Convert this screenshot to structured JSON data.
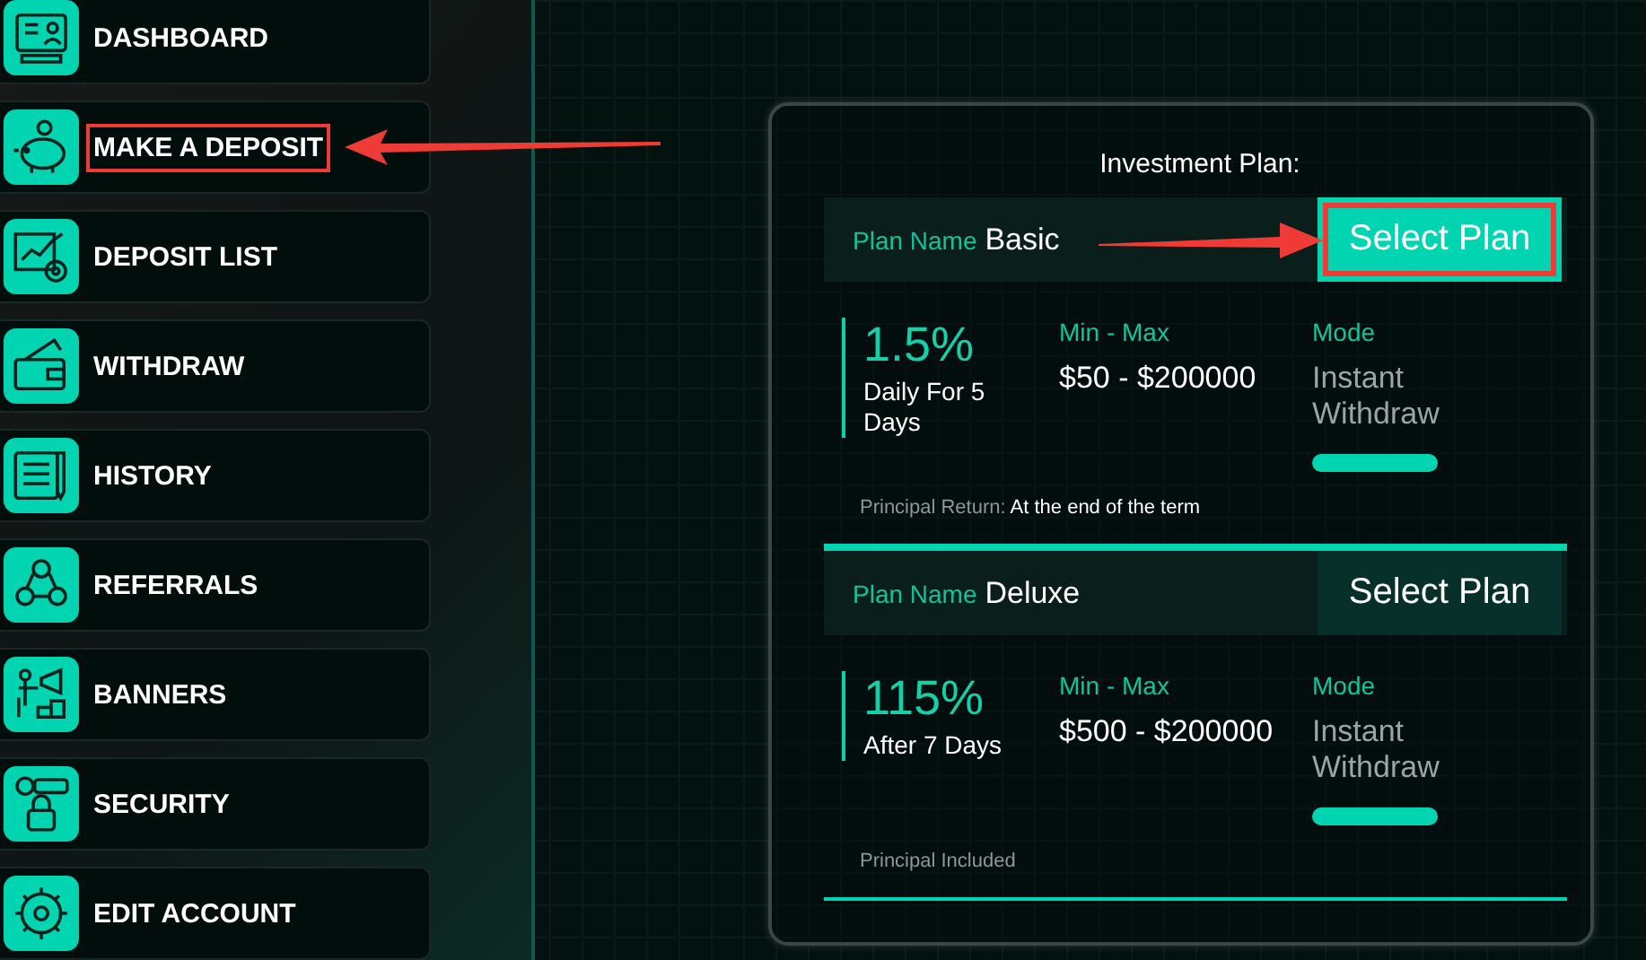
{
  "sidebar": {
    "items": [
      {
        "label": "DASHBOARD",
        "highlighted": false
      },
      {
        "label": "MAKE A DEPOSIT",
        "highlighted": true
      },
      {
        "label": "DEPOSIT LIST",
        "highlighted": false
      },
      {
        "label": "WITHDRAW",
        "highlighted": false
      },
      {
        "label": "HISTORY",
        "highlighted": false
      },
      {
        "label": "REFERRALS",
        "highlighted": false
      },
      {
        "label": "BANNERS",
        "highlighted": false
      },
      {
        "label": "SECURITY",
        "highlighted": false
      },
      {
        "label": "EDIT ACCOUNT",
        "highlighted": false
      }
    ]
  },
  "investment": {
    "title": "Investment Plan:",
    "plans": [
      {
        "name_label": "Plan Name",
        "name": "Basic",
        "button": "Select Plan",
        "selected": true,
        "highlighted": true,
        "rate": "1.5%",
        "term": "Daily For 5 Days",
        "range_label": "Min - Max",
        "range": "$50 - $200000",
        "mode_label": "Mode",
        "mode": "Instant Withdraw",
        "principal_label": "Principal Return:",
        "principal_value": "At the end of the term"
      },
      {
        "name_label": "Plan Name",
        "name": "Deluxe",
        "button": "Select Plan",
        "selected": false,
        "highlighted": false,
        "rate": "115%",
        "term": "After 7 Days",
        "range_label": "Min - Max",
        "range": "$500 - $200000",
        "mode_label": "Mode",
        "mode": "Instant Withdraw",
        "principal_label": "Principal Included"
      }
    ]
  }
}
